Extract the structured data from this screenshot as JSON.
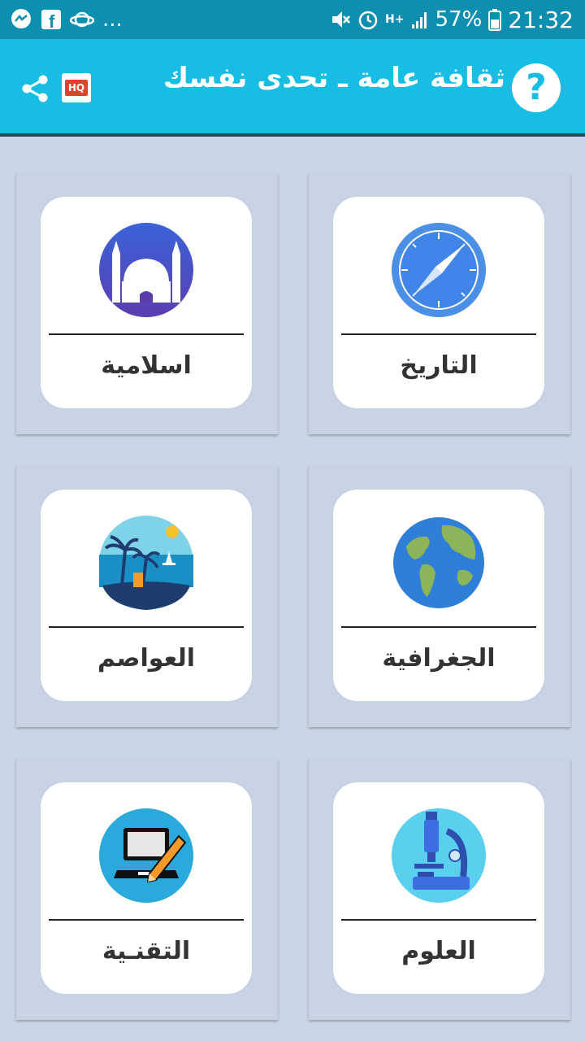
{
  "status_bar": {
    "left_icons": [
      "messenger-icon",
      "facebook-icon",
      "planet-icon"
    ],
    "overflow": "...",
    "right_icons": [
      "mute-icon",
      "alarm-icon",
      "network-hplus-icon",
      "signal-icon"
    ],
    "network": "H+",
    "battery": "57%",
    "time": "21:32"
  },
  "app_bar": {
    "title": "ثقافة عامة ـ تحدى نفسك",
    "help_icon": "question-mark-icon",
    "help_glyph": "?",
    "hq_label": "HQ",
    "share_icon": "share-icon",
    "color": "#17bde3"
  },
  "categories": [
    {
      "label": "التاريخ",
      "icon": "compass-icon"
    },
    {
      "label": "اسلامية",
      "icon": "mosque-icon"
    },
    {
      "label": "الجغرافية",
      "icon": "globe-icon"
    },
    {
      "label": "العواصم",
      "icon": "beach-icon"
    },
    {
      "label": "العلوم",
      "icon": "microscope-icon"
    },
    {
      "label": "التقنـية",
      "icon": "laptop-pencil-icon"
    }
  ]
}
